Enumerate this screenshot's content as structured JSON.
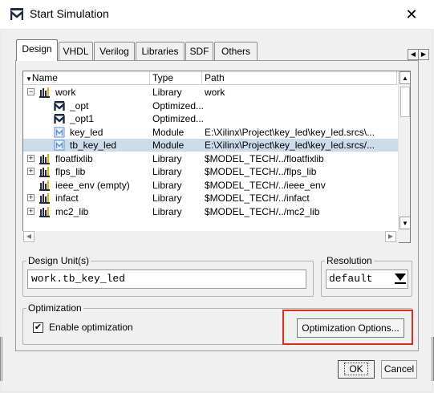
{
  "window": {
    "title": "Start Simulation",
    "close_glyph": "✕"
  },
  "tabs": [
    "Design",
    "VHDL",
    "Verilog",
    "Libraries",
    "SDF",
    "Others"
  ],
  "list": {
    "columns": [
      "Name",
      "Type",
      "Path"
    ],
    "rows": [
      {
        "expander": "−",
        "icon": "library-icon",
        "name": "work",
        "type": "Library",
        "path": "work",
        "selected": false
      },
      {
        "expander": "",
        "icon": "optimized-icon",
        "name": "_opt",
        "type": "Optimized...",
        "path": "",
        "selected": false
      },
      {
        "expander": "",
        "icon": "optimized-icon",
        "name": "_opt1",
        "type": "Optimized...",
        "path": "",
        "selected": false
      },
      {
        "expander": "",
        "icon": "module-icon",
        "name": "key_led",
        "type": "Module",
        "path": "E:\\Xilinx\\Project\\key_led\\key_led.srcs\\...",
        "selected": false
      },
      {
        "expander": "",
        "icon": "module-icon",
        "name": "tb_key_led",
        "type": "Module",
        "path": "E:\\Xilinx\\Project\\key_led\\key_led.srcs/...",
        "selected": true
      },
      {
        "expander": "+",
        "icon": "library-icon",
        "name": "floatfixlib",
        "type": "Library",
        "path": "$MODEL_TECH/../floatfixlib",
        "selected": false
      },
      {
        "expander": "+",
        "icon": "library-icon",
        "name": "flps_lib",
        "type": "Library",
        "path": "$MODEL_TECH/../flps_lib",
        "selected": false
      },
      {
        "expander": "",
        "icon": "library-icon",
        "name": "ieee_env  (empty)",
        "type": "Library",
        "path": "$MODEL_TECH/../ieee_env",
        "selected": false
      },
      {
        "expander": "+",
        "icon": "library-icon",
        "name": "infact",
        "type": "Library",
        "path": "$MODEL_TECH/../infact",
        "selected": false
      },
      {
        "expander": "+",
        "icon": "library-icon",
        "name": "mc2_lib",
        "type": "Library",
        "path": "$MODEL_TECH/../mc2_lib",
        "selected": false
      }
    ]
  },
  "design_unit": {
    "legend": "Design Unit(s)",
    "value": "work.tb_key_led"
  },
  "resolution": {
    "legend": "Resolution",
    "value": "default"
  },
  "optimization": {
    "legend": "Optimization",
    "enable_label": "Enable optimization",
    "enabled": true,
    "options_button": "Optimization Options..."
  },
  "buttons": {
    "ok": "OK",
    "cancel": "Cancel"
  },
  "colors": {
    "highlight": "#e8291c",
    "selected_row": "#cddcea",
    "icon_dark": "#1f2a44",
    "icon_blue": "#5b8fd6"
  }
}
